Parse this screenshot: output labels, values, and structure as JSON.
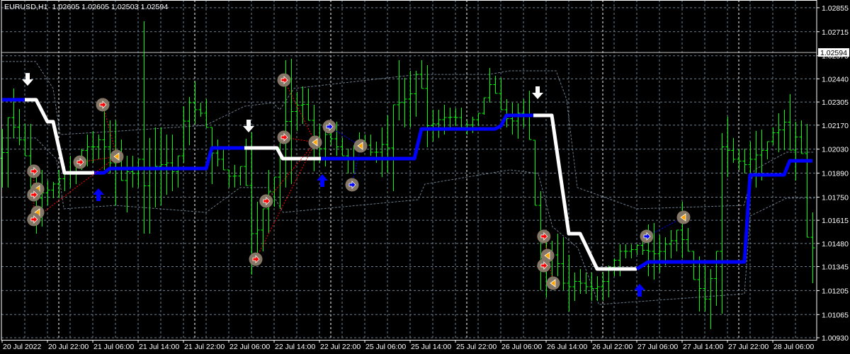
{
  "header": {
    "symbol": "EURUSD,H1",
    "ohlc": "1.02605 1.02605 1.02503 1.02594"
  },
  "colors": {
    "background": "#000000",
    "grid": "#708090",
    "bar": "#00ff00",
    "uptrend": "#0000ff",
    "downtrend": "#ffffff",
    "band": "#6a7a8a",
    "marker_bg": "#857766",
    "marker_red": "#ff0000",
    "marker_orange": "#ffa500",
    "marker_blue": "#0000ff"
  },
  "chart_data": {
    "type": "bar",
    "title": "EURUSD,H1",
    "current_price": "1.02594",
    "ylim": [
      1.0093,
      1.029
    ],
    "y_ticks": [
      "1.02855",
      "1.02715",
      "1.02575",
      "1.02440",
      "1.02305",
      "1.02170",
      "1.02030",
      "1.01890",
      "1.01750",
      "1.01615",
      "1.01480",
      "1.01345",
      "1.01205",
      "1.01065",
      "1.00930"
    ],
    "x_ticks": [
      "20 Jul 2022",
      "20 Jul 22:00",
      "21 Jul 06:00",
      "21 Jul 14:00",
      "21 Jul 22:00",
      "22 Jul 06:00",
      "22 Jul 14:00",
      "22 Jul 22:00",
      "25 Jul 06:00",
      "25 Jul 14:00",
      "25 Jul 22:00",
      "26 Jul 06:00",
      "26 Jul 14:00",
      "26 Jul 22:00",
      "27 Jul 06:00",
      "27 Jul 14:00",
      "27 Jul 22:00",
      "28 Jul 06:00"
    ],
    "bars_per_x_tick": 8,
    "day_separators_bar": [
      10,
      34,
      58,
      82,
      106,
      130
    ],
    "bars_high_low": [
      [
        1.02148,
        1.01806
      ],
      [
        1.02214,
        1.01806
      ],
      [
        1.02384,
        1.02095
      ],
      [
        1.02264,
        1.02053
      ],
      [
        1.02177,
        1.01991
      ],
      [
        1.02177,
        1.01744
      ],
      [
        1.01909,
        1.01537
      ],
      [
        1.01909,
        1.01578
      ],
      [
        1.01847,
        1.01702
      ],
      [
        1.01839,
        1.01744
      ],
      [
        1.01909,
        1.01744
      ],
      [
        1.01929,
        1.01785
      ],
      [
        1.01991,
        1.01806
      ],
      [
        1.01971,
        1.01826
      ],
      [
        1.02033,
        1.01909
      ],
      [
        1.02115,
        1.01929
      ],
      [
        1.02136,
        1.0195
      ],
      [
        1.02115,
        1.01971
      ],
      [
        1.0226,
        1.01909
      ],
      [
        1.02198,
        1.01888
      ],
      [
        1.02198,
        1.01702
      ],
      [
        1.02086,
        1.01847
      ],
      [
        1.01991,
        1.01661
      ],
      [
        1.01991,
        1.01806
      ],
      [
        1.01971,
        1.01806
      ],
      [
        1.02776,
        1.01537
      ],
      [
        1.02095,
        1.01537
      ],
      [
        1.02157,
        1.0169
      ],
      [
        1.02157,
        1.01702
      ],
      [
        1.02115,
        1.01764
      ],
      [
        1.02115,
        1.01785
      ],
      [
        1.01991,
        1.01806
      ],
      [
        1.0228,
        1.0195
      ],
      [
        1.02334,
        1.02053
      ],
      [
        1.02425,
        1.02177
      ],
      [
        1.02301,
        1.02219
      ],
      [
        1.02322,
        1.02157
      ],
      [
        1.02157,
        1.01826
      ],
      [
        1.02086,
        1.01929
      ],
      [
        1.02033,
        1.01909
      ],
      [
        1.01909,
        1.01806
      ],
      [
        1.01938,
        1.01806
      ],
      [
        1.01929,
        1.01818
      ],
      [
        1.02091,
        1.01818
      ],
      [
        1.02128,
        1.01298
      ],
      [
        1.01723,
        1.01351
      ],
      [
        1.01682,
        1.01434
      ],
      [
        1.01909,
        1.01537
      ],
      [
        1.01867,
        1.01694
      ],
      [
        1.02074,
        1.01682
      ],
      [
        1.02549,
        1.01806
      ],
      [
        1.02557,
        1.01826
      ],
      [
        1.02363,
        1.02136
      ],
      [
        1.02396,
        1.02177
      ],
      [
        1.02384,
        1.02198
      ],
      [
        1.02289,
        1.01901
      ],
      [
        1.02177,
        1.0195
      ],
      [
        1.02136,
        1.01929
      ],
      [
        1.02177,
        1.02053
      ],
      [
        1.0219,
        1.01991
      ],
      [
        1.02095,
        1.01991
      ],
      [
        1.02033,
        1.01888
      ],
      [
        1.02053,
        1.01888
      ],
      [
        1.02128,
        1.02012
      ],
      [
        1.02115,
        1.02024
      ],
      [
        1.02115,
        1.01991
      ],
      [
        1.02074,
        1.0195
      ],
      [
        1.02157,
        1.01867
      ],
      [
        1.02227,
        1.01888
      ],
      [
        1.02289,
        1.01785
      ],
      [
        1.02549,
        1.02198
      ],
      [
        1.02446,
        1.02157
      ],
      [
        1.02487,
        1.02157
      ],
      [
        1.02487,
        1.02219
      ],
      [
        1.02549,
        1.02384
      ],
      [
        1.0252,
        1.02041
      ],
      [
        1.0226,
        1.02074
      ],
      [
        1.0226,
        1.02095
      ],
      [
        1.02289,
        1.02115
      ],
      [
        1.02272,
        1.02157
      ],
      [
        1.02268,
        1.02165
      ],
      [
        1.02272,
        1.02157
      ],
      [
        1.02198,
        1.02115
      ],
      [
        1.02219,
        1.02124
      ],
      [
        1.02239,
        1.02165
      ],
      [
        1.0233,
        1.02231
      ],
      [
        1.02504,
        1.02301
      ],
      [
        1.02458,
        1.02355
      ],
      [
        1.02446,
        1.0226
      ],
      [
        1.02322,
        1.02157
      ],
      [
        1.02301,
        1.02115
      ],
      [
        1.02297,
        1.02091
      ],
      [
        1.02322,
        1.02157
      ],
      [
        1.02371,
        1.02086
      ],
      [
        1.02082,
        1.01702
      ],
      [
        1.01785,
        1.01207
      ],
      [
        1.01537,
        1.01165
      ],
      [
        1.01496,
        1.01269
      ],
      [
        1.01537,
        1.01289
      ],
      [
        1.01516,
        1.01207
      ],
      [
        1.01413,
        1.01083
      ],
      [
        1.0131,
        1.01145
      ],
      [
        1.01331,
        1.01186
      ],
      [
        1.0131,
        1.01186
      ],
      [
        1.0131,
        1.01145
      ],
      [
        1.01289,
        1.01145
      ],
      [
        1.0131,
        1.01145
      ],
      [
        1.01351,
        1.01165
      ],
      [
        1.01393,
        1.01289
      ],
      [
        1.01475,
        1.01289
      ],
      [
        1.01475,
        1.01393
      ],
      [
        1.01475,
        1.01393
      ],
      [
        1.01475,
        1.01413
      ],
      [
        1.01525,
        1.01413
      ],
      [
        1.01591,
        1.01289
      ],
      [
        1.01599,
        1.01269
      ],
      [
        1.01529,
        1.0131
      ],
      [
        1.01516,
        1.01351
      ],
      [
        1.01558,
        1.01393
      ],
      [
        1.01558,
        1.01434
      ],
      [
        1.01723,
        1.01393
      ],
      [
        1.0157,
        1.01434
      ],
      [
        1.01434,
        1.01269
      ],
      [
        1.01405,
        1.01083
      ],
      [
        1.01351,
        1.01083
      ],
      [
        1.01331,
        1.0098
      ],
      [
        1.01434,
        1.01116
      ],
      [
        1.02124,
        1.0107
      ],
      [
        1.02219,
        1.01867
      ],
      [
        1.02095,
        1.0195
      ],
      [
        1.02033,
        1.01909
      ],
      [
        1.02033,
        1.01888
      ],
      [
        1.02074,
        1.01806
      ],
      [
        1.02136,
        1.01806
      ],
      [
        1.02144,
        1.01847
      ],
      [
        1.02074,
        1.01971
      ],
      [
        1.02157,
        1.02053
      ],
      [
        1.02239,
        1.02012
      ],
      [
        1.0226,
        1.02024
      ],
      [
        1.02351,
        1.02024
      ],
      [
        1.0219,
        1.01847
      ],
      [
        1.02198,
        1.02004
      ],
      [
        1.02177,
        1.01516
      ],
      [
        1.01661,
        1.01248
      ]
    ],
    "trend_line": [
      {
        "trend": "up",
        "points": [
          [
            0,
            1.02318
          ],
          [
            4,
            1.02318
          ]
        ]
      },
      {
        "trend": "down",
        "points": [
          [
            4,
            1.02318
          ],
          [
            6,
            1.02318
          ],
          [
            8,
            1.0219
          ],
          [
            9,
            1.0219
          ],
          [
            11,
            1.01892
          ],
          [
            16.25,
            1.01892
          ]
        ]
      },
      {
        "trend": "up",
        "points": [
          [
            16.25,
            1.01892
          ],
          [
            18,
            1.01892
          ],
          [
            19,
            1.01917
          ],
          [
            36,
            1.01917
          ],
          [
            37,
            1.02037
          ],
          [
            42.75,
            1.02037
          ]
        ]
      },
      {
        "trend": "down",
        "points": [
          [
            42.75,
            1.02037
          ],
          [
            48.5,
            1.02037
          ],
          [
            49.5,
            1.01975
          ],
          [
            56.25,
            1.01975
          ]
        ]
      },
      {
        "trend": "up",
        "points": [
          [
            56.25,
            1.01975
          ],
          [
            72.75,
            1.01975
          ],
          [
            74,
            1.02148
          ],
          [
            87,
            1.02148
          ],
          [
            88,
            1.02165
          ],
          [
            89,
            1.02227
          ],
          [
            93.75,
            1.02227
          ]
        ]
      },
      {
        "trend": "down",
        "points": [
          [
            93.75,
            1.02227
          ],
          [
            97,
            1.02227
          ],
          [
            100,
            1.01537
          ],
          [
            102,
            1.01537
          ],
          [
            105,
            1.01331
          ],
          [
            112,
            1.01331
          ]
        ]
      },
      {
        "trend": "up",
        "points": [
          [
            112,
            1.01331
          ],
          [
            114,
            1.01372
          ],
          [
            131,
            1.01372
          ],
          [
            132,
            1.0188
          ],
          [
            138,
            1.0188
          ],
          [
            139,
            1.01962
          ],
          [
            143,
            1.01962
          ]
        ]
      }
    ],
    "upper_band": [
      [
        0,
        1.02541
      ],
      [
        5.9,
        1.02541
      ],
      [
        9,
        1.02384
      ],
      [
        10.25,
        1.02115
      ],
      [
        20.9,
        1.02136
      ],
      [
        35.9,
        1.02169
      ],
      [
        42.75,
        1.0228
      ],
      [
        47.75,
        1.02301
      ],
      [
        49,
        1.0226
      ],
      [
        51.5,
        1.02384
      ],
      [
        73.4,
        1.02466
      ],
      [
        85.9,
        1.02466
      ],
      [
        89.6,
        1.02487
      ],
      [
        97.75,
        1.02487
      ],
      [
        99.6,
        1.02322
      ],
      [
        101.5,
        1.01806
      ],
      [
        112,
        1.01682
      ],
      [
        130.9,
        1.01702
      ],
      [
        132.75,
        1.01909
      ],
      [
        138.4,
        1.02012
      ],
      [
        143.4,
        1.02012
      ]
    ],
    "lower_band": [
      [
        0,
        1.02095
      ],
      [
        5.9,
        1.02095
      ],
      [
        9.6,
        1.01971
      ],
      [
        10.9,
        1.01682
      ],
      [
        20,
        1.01702
      ],
      [
        36,
        1.01661
      ],
      [
        42,
        1.01806
      ],
      [
        47,
        1.01806
      ],
      [
        49.6,
        1.01661
      ],
      [
        73.4,
        1.01735
      ],
      [
        74.6,
        1.01826
      ],
      [
        89.6,
        1.01909
      ],
      [
        94.6,
        1.01888
      ],
      [
        97.1,
        1.01578
      ],
      [
        101.6,
        1.01454
      ],
      [
        105.3,
        1.01124
      ],
      [
        131,
        1.01186
      ],
      [
        132,
        1.0164
      ],
      [
        138.4,
        1.01744
      ],
      [
        143.4,
        1.01744
      ]
    ],
    "signals": [
      {
        "type": "sell",
        "bar": 4.5,
        "price": 1.02437
      },
      {
        "type": "sell",
        "bar": 43.5,
        "price": 1.02165
      },
      {
        "type": "sell",
        "bar": 94.5,
        "price": 1.02359
      },
      {
        "type": "buy",
        "bar": 17,
        "price": 1.01764
      },
      {
        "type": "buy",
        "bar": 56.5,
        "price": 1.01847
      },
      {
        "type": "buy",
        "bar": 112.5,
        "price": 1.01207
      }
    ],
    "markers": [
      {
        "kind": "red",
        "bar": 5.6,
        "price": 1.01901
      },
      {
        "kind": "orange",
        "bar": 6.25,
        "price": 1.01797
      },
      {
        "kind": "red",
        "bar": 5.6,
        "price": 1.01764
      },
      {
        "kind": "orange",
        "bar": 6.25,
        "price": 1.01661
      },
      {
        "kind": "red",
        "bar": 5.6,
        "price": 1.0162
      },
      {
        "kind": "red",
        "bar": 17.75,
        "price": 1.02289
      },
      {
        "kind": "red",
        "bar": 13.75,
        "price": 1.01954
      },
      {
        "kind": "orange",
        "bar": 20.25,
        "price": 1.01987
      },
      {
        "kind": "red",
        "bar": 49.75,
        "price": 1.02433
      },
      {
        "kind": "red",
        "bar": 49.75,
        "price": 1.02099
      },
      {
        "kind": "red",
        "bar": 46.6,
        "price": 1.01727
      },
      {
        "kind": "red",
        "bar": 44.75,
        "price": 1.01388
      },
      {
        "kind": "orange",
        "bar": 55.25,
        "price": 1.0207
      },
      {
        "kind": "blue",
        "bar": 57.75,
        "price": 1.02161
      },
      {
        "kind": "orange",
        "bar": 63.25,
        "price": 1.02049
      },
      {
        "kind": "blue",
        "bar": 61.75,
        "price": 1.01822
      },
      {
        "kind": "red",
        "bar": 95.6,
        "price": 1.01521
      },
      {
        "kind": "orange",
        "bar": 96.25,
        "price": 1.01409
      },
      {
        "kind": "red",
        "bar": 95.6,
        "price": 1.01351
      },
      {
        "kind": "orange",
        "bar": 97.25,
        "price": 1.01248
      },
      {
        "kind": "blue",
        "bar": 113.75,
        "price": 1.01521
      },
      {
        "kind": "orange",
        "bar": 120.25,
        "price": 1.01632
      }
    ],
    "links": [
      {
        "color": "red",
        "from": 4,
        "to": 7
      },
      {
        "color": "red",
        "from": 0,
        "to": 4
      },
      {
        "color": "red",
        "from": 5,
        "to": 7
      },
      {
        "color": "red",
        "from": 6,
        "to": 7
      },
      {
        "color": "red",
        "from": 8,
        "to": 12
      },
      {
        "color": "red",
        "from": 9,
        "to": 12
      },
      {
        "color": "red",
        "from": 10,
        "to": 12
      },
      {
        "color": "red",
        "from": 11,
        "to": 12
      },
      {
        "color": "blue",
        "from": 13,
        "to": 14
      },
      {
        "color": "blue",
        "from": 14,
        "to": 15
      },
      {
        "color": "red",
        "from": 16,
        "to": 19
      },
      {
        "color": "blue",
        "from": 20,
        "to": 21
      }
    ]
  }
}
